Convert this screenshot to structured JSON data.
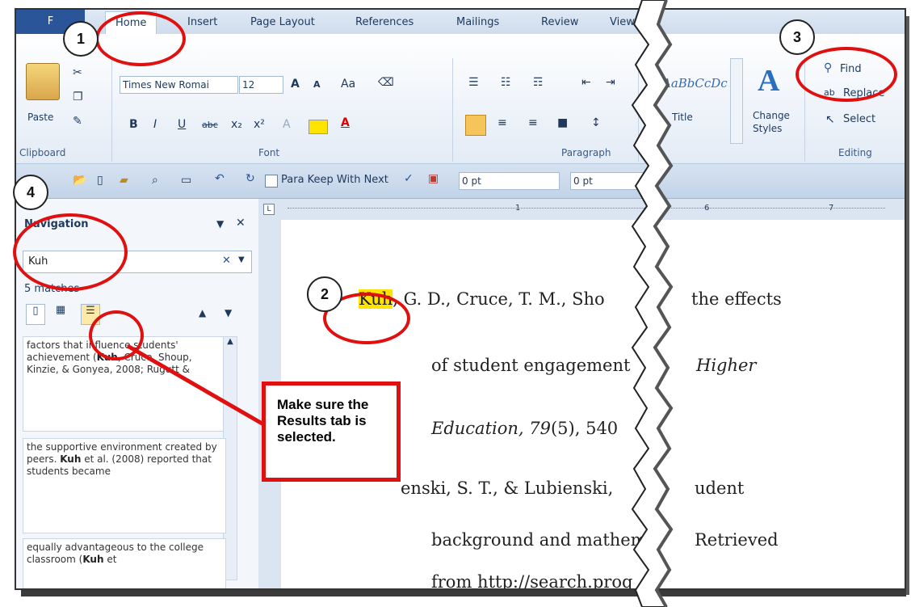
{
  "ribbon": {
    "file_label": "F",
    "tabs": [
      "Home",
      "Insert",
      "Page Layout",
      "References",
      "Mailings",
      "Review",
      "View"
    ],
    "clipboard": {
      "paste": "Paste",
      "group": "Clipboard"
    },
    "font": {
      "name": "Times New Romai",
      "size": "12",
      "group": "Font",
      "case": "Aa"
    },
    "paragraph": {
      "group": "Paragraph"
    },
    "styles": {
      "sample": "AaBbCcDc",
      "title": "Title",
      "change": "Change",
      "styles": "Styles"
    },
    "editing": {
      "find": "Find",
      "replace": "Replace",
      "select": "Select",
      "group": "Editing"
    }
  },
  "qat": {
    "para_keep": "Para Keep With Next",
    "spacing1": "0 pt",
    "spacing2": "0 pt"
  },
  "navigation": {
    "title": "Navigation",
    "search_value": "Kuh",
    "matches": "5 matches",
    "results": [
      {
        "pre": "factors that influence students' achievement (",
        "match": "Kuh",
        "post": ", Cruce, Shoup, Kinzie, & Gonyea, 2008; Rugutt &"
      },
      {
        "pre": "the supportive environment created by peers. ",
        "match": "Kuh",
        "post": " et al. (2008) reported that students became"
      },
      {
        "pre": "equally advantageous to the college classroom (",
        "match": "Kuh",
        "post": " et"
      }
    ]
  },
  "document": {
    "ruler_marks": [
      "1",
      "6",
      "7"
    ],
    "lines": [
      {
        "hl": "Kuh",
        "text": ", G. D., Cruce, T. M., Sho"
      },
      {
        "text": "of student engagement"
      },
      {
        "italic": "Education, 79",
        "text": "(5), 540"
      },
      {
        "text": "enski, S. T., & Lubienski,"
      },
      {
        "text": "background and mathem"
      },
      {
        "text": "from http://search.proq"
      }
    ],
    "right_lines": [
      "the effects",
      "Higher",
      "udent",
      "Retrieved"
    ]
  },
  "callouts": {
    "numbers": [
      "1",
      "2",
      "3",
      "4"
    ],
    "note": "Make sure the Results tab is selected."
  },
  "colors": {
    "accent": "#2a5699",
    "highlight": "#ffe400",
    "callout": "#e01010"
  }
}
